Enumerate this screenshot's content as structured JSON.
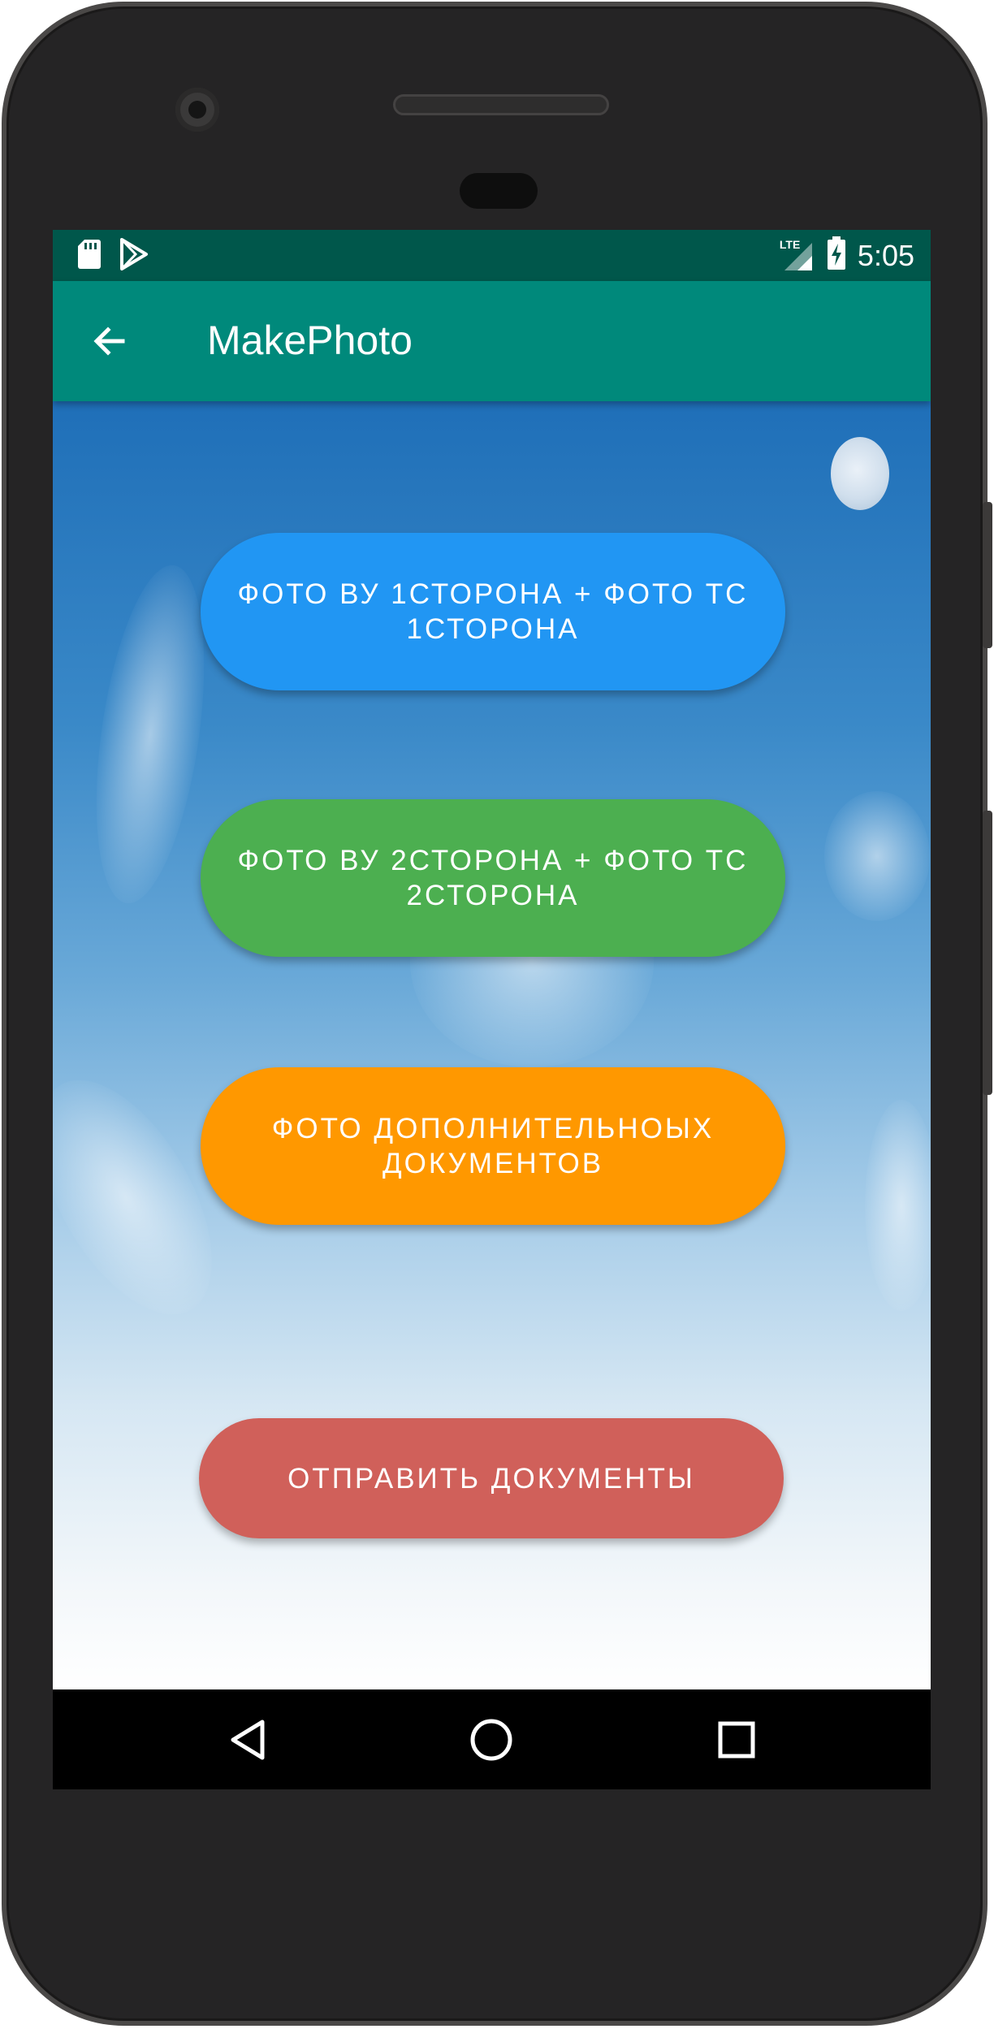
{
  "status_bar": {
    "time": "5:05",
    "network": "LTE",
    "icons": [
      "sd-card-icon",
      "play-store-icon",
      "signal-icon",
      "battery-charging-icon"
    ]
  },
  "app_bar": {
    "title": "MakePhoto",
    "back_icon": "arrow-left-icon"
  },
  "buttons": [
    {
      "label": "ФОТО ВУ 1СТОРОНА + ФОТО ТС 1СТОРОНА",
      "color": "#2196f3"
    },
    {
      "label": "ФОТО ВУ 2СТОРОНА + ФОТО ТС 2СТОРОНА",
      "color": "#4caf50"
    },
    {
      "label": "ФОТО ДОПОЛНИТЕЛЬНОЫХ ДОКУМЕНТОВ",
      "color": "#ff9800"
    },
    {
      "label": "ОТПРАВИТЬ ДОКУМЕНТЫ",
      "color": "#d0605a"
    }
  ],
  "nav_bar": {
    "back": "triangle-back-icon",
    "home": "circle-home-icon",
    "recents": "square-recents-icon"
  },
  "colors": {
    "status_bar": "#00574b",
    "app_bar": "#00897b"
  }
}
